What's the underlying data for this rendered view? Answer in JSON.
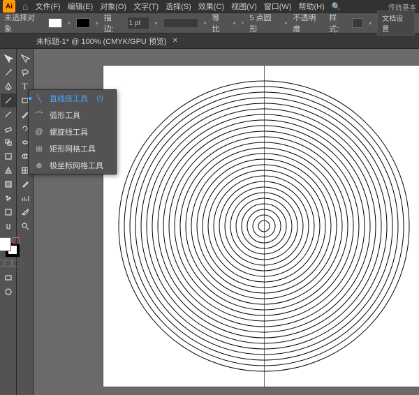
{
  "menubar": {
    "logo": "Ai",
    "items": [
      "文件(F)",
      "编辑(E)",
      "对象(O)",
      "文字(T)",
      "选择(S)",
      "效果(C)",
      "视图(V)",
      "窗口(W)",
      "帮助(H)"
    ],
    "right": "传统基本"
  },
  "controlbar": {
    "selection": "未选择对象",
    "stroke_label": "描边:",
    "stroke_value": "1 pt",
    "uniform": "等比",
    "profile": "5 点圆形",
    "opacity_label": "不透明度",
    "style_label": "样式:",
    "docsetup": "文档设置"
  },
  "tab": {
    "title": "未标题-1* @ 100% (CMYK/GPU 预览)"
  },
  "flyout": {
    "items": [
      {
        "label": "直线段工具",
        "shortcut": "(\\)",
        "selected": true,
        "icon": "line-icon"
      },
      {
        "label": "弧形工具",
        "shortcut": "",
        "selected": false,
        "icon": "arc-icon"
      },
      {
        "label": "螺旋线工具",
        "shortcut": "",
        "selected": false,
        "icon": "spiral-icon"
      },
      {
        "label": "矩形网格工具",
        "shortcut": "",
        "selected": false,
        "icon": "grid-icon"
      },
      {
        "label": "极坐标网格工具",
        "shortcut": "",
        "selected": false,
        "icon": "polar-icon"
      }
    ]
  },
  "tools": {
    "names": [
      "selection",
      "direct-selection",
      "magic-wand",
      "lasso",
      "pen",
      "type",
      "line",
      "rect",
      "brush",
      "pencil",
      "eraser",
      "rotate",
      "scale",
      "width",
      "free-transform",
      "shape-builder",
      "perspective",
      "mesh",
      "gradient",
      "eyedropper",
      "blend",
      "symbol-spray",
      "graph",
      "artboard",
      "slice",
      "hand",
      "zoom"
    ]
  },
  "colors": {
    "accent": "#4aa3ff",
    "panel": "#535353"
  }
}
